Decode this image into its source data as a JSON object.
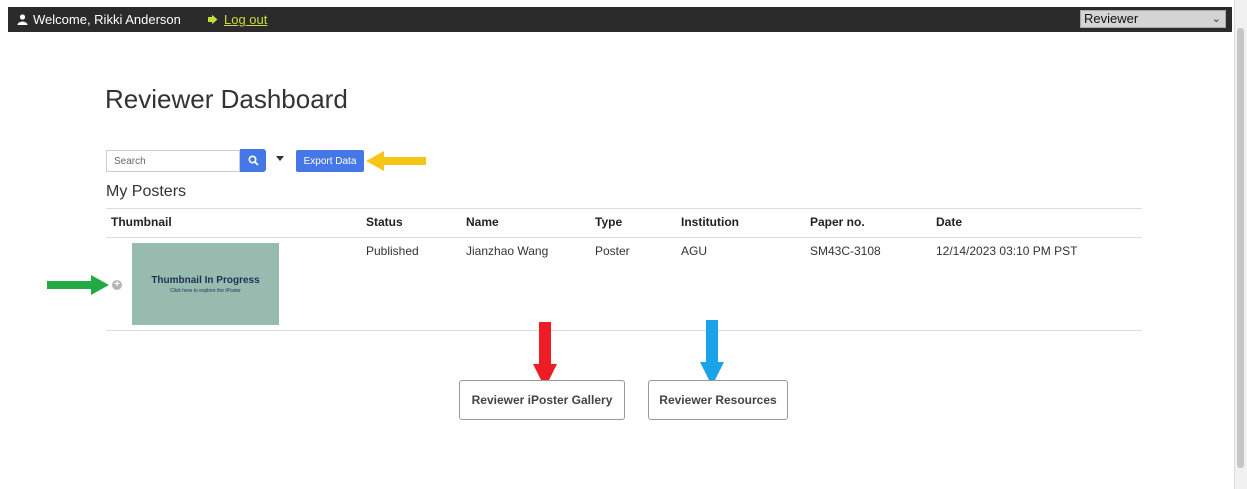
{
  "topbar": {
    "welcome_text": "Welcome, Rikki Anderson",
    "logout_label": "Log out",
    "role_selected": "Reviewer"
  },
  "page": {
    "title": "Reviewer Dashboard"
  },
  "toolbar": {
    "search_placeholder": "Search",
    "export_label": "Export Data"
  },
  "section": {
    "title": "My Posters"
  },
  "table": {
    "headers": [
      "Thumbnail",
      "Status",
      "Name",
      "Type",
      "Institution",
      "Paper no.",
      "Date"
    ],
    "rows": [
      {
        "thumbnail_title": "Thumbnail In Progress",
        "thumbnail_caption": "Click here to explore the iPoster",
        "status": "Published",
        "name": "Jianzhao Wang",
        "type": "Poster",
        "institution": "AGU",
        "paper_no": "SM43C-3108",
        "date": "12/14/2023 03:10 PM PST"
      }
    ]
  },
  "buttons": {
    "gallery_label": "Reviewer iPoster Gallery",
    "resources_label": "Reviewer Resources"
  },
  "colors": {
    "topbar": "#2b2b2b",
    "accent_blue": "#4677e6",
    "logout_link": "#c8dc3a",
    "arrow_yellow": "#f5c518",
    "arrow_green": "#22aa44",
    "arrow_red": "#ee1c24",
    "arrow_blue": "#1aa3e8",
    "thumbnail_bg": "#98bbb0"
  },
  "icons": [
    "user-icon",
    "logout-icon",
    "search-icon",
    "chevron-down-icon",
    "caret-down-icon",
    "plus-circle-icon"
  ]
}
